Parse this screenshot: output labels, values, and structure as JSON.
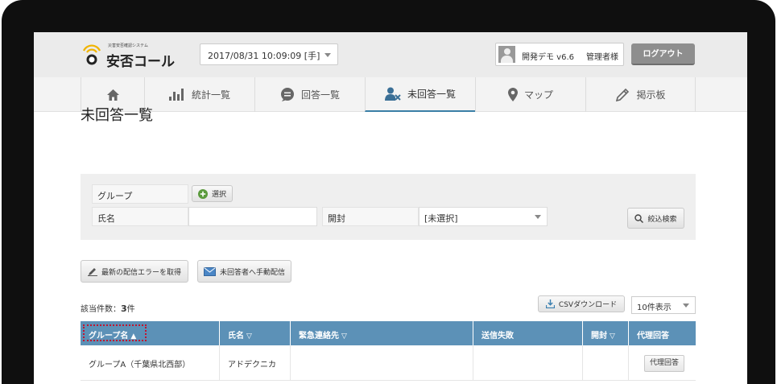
{
  "brand": {
    "logo_subtitle": "災害安否確認システム",
    "logo_name": "安否コール",
    "accent_color": "#f0b400"
  },
  "header": {
    "datetime": "2017/08/31 10:09:09 [手]",
    "user_name": "開発デモ v6.6",
    "user_role": "管理者様",
    "logout_label": "ログアウト"
  },
  "nav": {
    "items": [
      {
        "label": "",
        "icon": "home-icon"
      },
      {
        "label": "統計一覧",
        "icon": "bar-chart-icon"
      },
      {
        "label": "回答一覧",
        "icon": "chat-bubble-icon"
      },
      {
        "label": "未回答一覧",
        "icon": "user-x-icon",
        "active": true
      },
      {
        "label": "マップ",
        "icon": "map-pin-icon"
      },
      {
        "label": "掲示板",
        "icon": "pencil-icon"
      }
    ],
    "active_color": "#3a7fa6"
  },
  "page": {
    "title": "未回答一覧"
  },
  "filter": {
    "group_label": "グループ",
    "select_button": "選択",
    "name_label": "氏名",
    "name_value": "",
    "open_label": "開封",
    "open_value": "[未選択]",
    "search_button": "絞込検索"
  },
  "actions": {
    "latest_errors_button": "最新の配信エラーを取得",
    "manual_send_button": "未回答者へ手動配信",
    "csv_button": "CSVダウンロード"
  },
  "results": {
    "count_label": "該当件数：",
    "count_value": "3",
    "count_unit": "件",
    "per_page": "10件表示"
  },
  "table": {
    "header_color": "#5c91b7",
    "columns": [
      {
        "label": "グループ名",
        "sort": "▲"
      },
      {
        "label": "氏名",
        "sort": "▽"
      },
      {
        "label": "緊急連絡先",
        "sort": "▽"
      },
      {
        "label": "送信失敗",
        "sort": ""
      },
      {
        "label": "開封",
        "sort": "▽"
      },
      {
        "label": "代理回答",
        "sort": ""
      }
    ],
    "rows": [
      {
        "group": "グループA（千葉県北西部）",
        "name": "アドデクニカ",
        "emergency": "",
        "failed": "",
        "opened": "",
        "proxy_button": "代理回答"
      }
    ]
  }
}
